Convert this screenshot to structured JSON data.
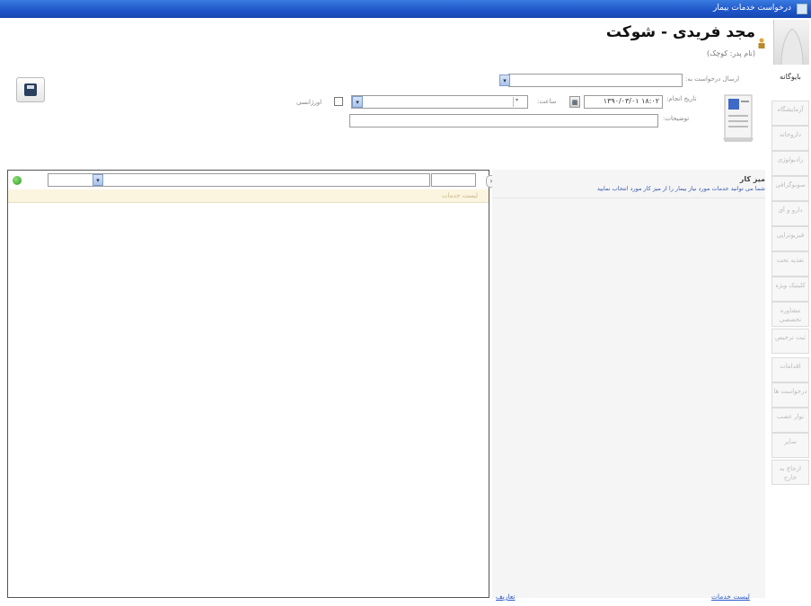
{
  "window": {
    "title": "درخواست خدمات بیمار"
  },
  "patient": {
    "name": "مجد فریدی - شوکت",
    "subtitle": "(نام پدر: کوچک)"
  },
  "tabs": [
    {
      "label": "بایوگانه",
      "active": true
    },
    {
      "label": "آزمایشگاه",
      "active": false
    },
    {
      "label": "داروخانه",
      "active": false
    },
    {
      "label": "رادیولوژی",
      "active": false
    },
    {
      "label": "سونوگرافی",
      "active": false
    },
    {
      "label": "دارو و آی",
      "active": false
    },
    {
      "label": "فیزیوتراپی",
      "active": false
    },
    {
      "label": "تغذیه تخت",
      "active": false
    },
    {
      "label": "کلینیک ویژه",
      "active": false
    },
    {
      "label": "مشاوره تخصصی",
      "active": false
    },
    {
      "label": "ثبت ترخیص",
      "active": false
    },
    {
      "label": "اقدامات",
      "active": false
    },
    {
      "label": "درخواست ها",
      "active": false
    },
    {
      "label": "نوار عصب",
      "active": false
    },
    {
      "label": "سایر",
      "active": false
    },
    {
      "label": "ارجاع به خارج",
      "active": false
    }
  ],
  "form": {
    "send_request_label": "ارسال درخواست به:",
    "send_request_value": "",
    "request_date_label": "تاریخ انجام:",
    "request_date_value": "۱۳۹۰/۰۳/۰۱ ۱۸:۰۲",
    "time_label": "ساعت:",
    "dropdown_value": "",
    "urgent_label": "اورژانسی",
    "urgent_checked": false,
    "description_label": "توضیحات:",
    "description_value": ""
  },
  "left_panel": {
    "search_value": "",
    "strip_text": "لیست خدمات"
  },
  "right_panel": {
    "title": "میز کار",
    "text": "شما می توانید خدمات مورد نیاز بیمار را از میز کار مورد انتخاب نمایید",
    "collapse_glyph": "›"
  },
  "footer": {
    "left_link": "تعاریف",
    "right_link": "لیست خدمات"
  },
  "icons": {
    "save": "save-icon",
    "check": "check-icon",
    "document": "document-icon",
    "dropdown": "chevron-down-icon",
    "calendar": "calendar-icon"
  },
  "colors": {
    "title_bar": "#1e55c8",
    "accent": "#2a57c8",
    "strip": "#fbf5e0"
  }
}
